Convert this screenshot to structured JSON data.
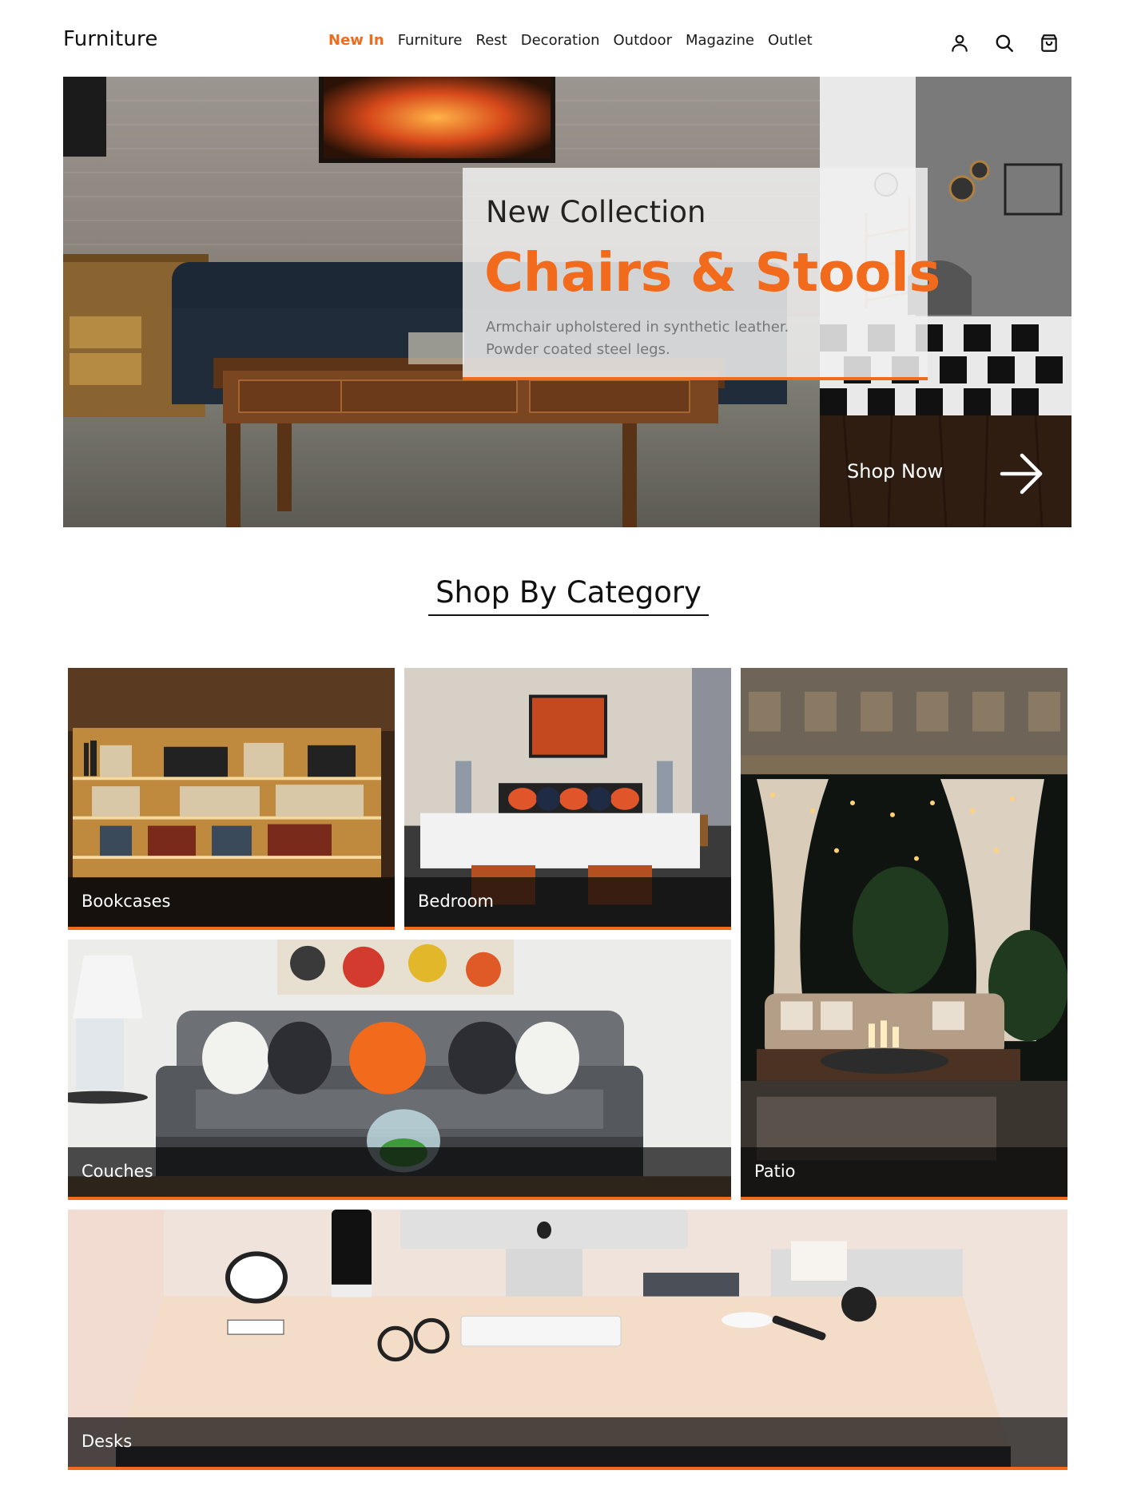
{
  "header": {
    "brand": "Furniture",
    "nav": [
      "New In",
      "Furniture",
      "Rest",
      "Decoration",
      "Outdoor",
      "Magazine",
      "Outlet"
    ],
    "active_nav": "New In",
    "icons": [
      "user-icon",
      "search-icon",
      "shopping-bag-icon"
    ]
  },
  "hero": {
    "kicker": "New Collection",
    "headline": "Chairs & Stools",
    "description_line1": "Armchair upholstered in synthetic leather.",
    "description_line2": "Powder coated steel legs.",
    "cta": "Shop Now"
  },
  "categories": {
    "title": "Shop By Category",
    "items": [
      "Bookcases",
      "Bedroom",
      "Couches",
      "Patio",
      "Desks"
    ]
  },
  "colors": {
    "accent": "#f26a1b",
    "text": "#111111",
    "overlay": "#0a0a0a"
  }
}
